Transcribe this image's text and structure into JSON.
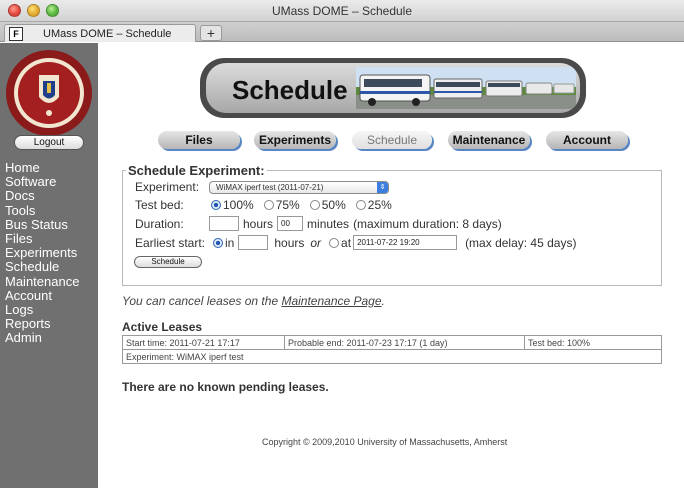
{
  "window": {
    "title": "UMass DOME – Schedule"
  },
  "browser_tab": {
    "label": "UMass DOME – Schedule",
    "new_tab": "+"
  },
  "sidebar": {
    "logout_label": "Logout",
    "items": [
      "Home",
      "Software",
      "Docs",
      "Tools",
      "Bus Status",
      "Files",
      "Experiments",
      "Schedule",
      "Maintenance",
      "Account",
      "Logs",
      "Reports",
      "Admin"
    ]
  },
  "banner": {
    "title": "Schedule"
  },
  "topnav": [
    "Files",
    "Experiments",
    "Schedule",
    "Maintenance",
    "Account"
  ],
  "schedule_form": {
    "legend": "Schedule Experiment:",
    "experiment_label": "Experiment:",
    "experiment_value": "WiMAX iperf test  (2011-07-21)",
    "testbed_label": "Test bed:",
    "testbed_options": [
      "100%",
      "75%",
      "50%",
      "25%"
    ],
    "testbed_selected": "100%",
    "duration_label": "Duration:",
    "duration_hours_value": "",
    "hours_text": "hours",
    "duration_minutes_value": "00",
    "minutes_text": "minutes",
    "duration_note": "(maximum duration: 8 days)",
    "earliest_label": "Earliest start:",
    "earliest_in": "in",
    "earliest_hours_value": "",
    "earliest_hours_text": "hours",
    "earliest_or": "or",
    "earliest_at": "at",
    "earliest_at_value": "2011-07-22 19:20",
    "delay_note": "(max delay: 45 days)",
    "schedule_button": "Schedule"
  },
  "cancel_note": {
    "prefix": "You can cancel leases on the ",
    "link": "Maintenance Page",
    "suffix": "."
  },
  "active_leases": {
    "title": "Active Leases",
    "start": "Start time: 2011-07-21 17:17",
    "end": "Probable end: 2011-07-23 17:17 (1 day)",
    "testbed": "Test bed: 100%",
    "experiment": "Experiment: WiMAX iperf test"
  },
  "pending": "There are no known pending leases.",
  "footer": {
    "copyright": "Copyright © 2009,2010 University of Massachusetts, Amherst"
  },
  "colors": {
    "sidebar_bg": "#707070",
    "tab_shadow": "#5a86c4",
    "radio_selected": "#1e55b0"
  }
}
